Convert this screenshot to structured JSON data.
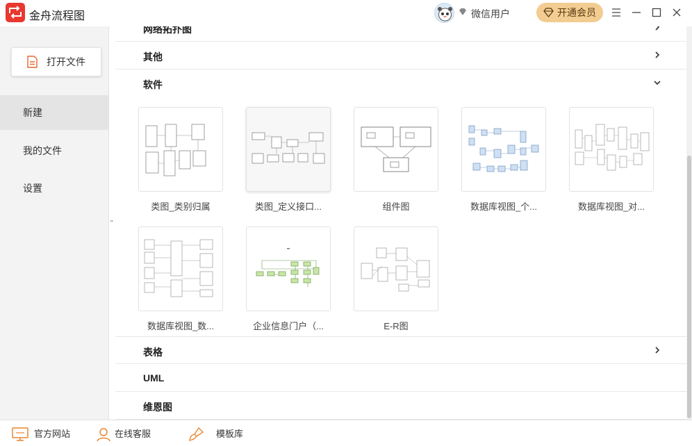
{
  "app": {
    "title": "金舟流程图",
    "accent": "#e8382f"
  },
  "user": {
    "name": "微信用户",
    "vip_label": "开通会员"
  },
  "sidebar": {
    "open_file": "打开文件",
    "items": [
      {
        "label": "新建",
        "active": true
      },
      {
        "label": "我的文件",
        "active": false
      },
      {
        "label": "设置",
        "active": false
      }
    ]
  },
  "categories": {
    "network": "网络拓扑图",
    "other": "其他",
    "software": "软件",
    "table": "表格",
    "uml": "UML",
    "venn": "维恩图"
  },
  "templates": [
    {
      "label": "类图_类别归属",
      "icon": "class-diagram-thumbnail"
    },
    {
      "label": "类图_定义接口...",
      "icon": "class-interface-thumbnail"
    },
    {
      "label": "组件图",
      "icon": "component-diagram-thumbnail"
    },
    {
      "label": "数据库视图_个...",
      "icon": "database-view-thumbnail"
    },
    {
      "label": "数据库视图_对...",
      "icon": "database-view-thumbnail"
    },
    {
      "label": "数据库视图_数...",
      "icon": "database-view-thumbnail"
    },
    {
      "label": "企业信息门户（...",
      "icon": "portal-flow-thumbnail"
    },
    {
      "label": "E-R图",
      "icon": "er-diagram-thumbnail"
    }
  ],
  "bottom": {
    "website": "官方网站",
    "support": "在线客服",
    "templates": "模板库"
  }
}
